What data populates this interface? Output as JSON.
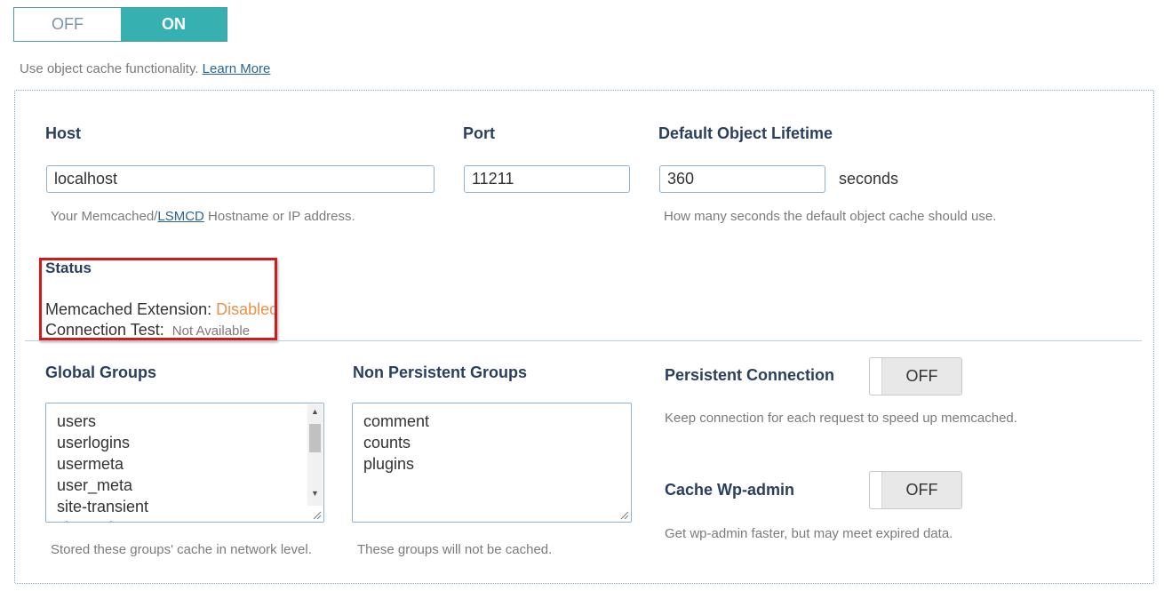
{
  "object_cache_toggle": {
    "off_label": "OFF",
    "on_label": "ON",
    "selected": "ON"
  },
  "intro": {
    "text": "Use object cache functionality.",
    "link_label": "Learn More"
  },
  "host": {
    "label": "Host",
    "value": "localhost",
    "help_prefix": "Your Memcached/",
    "help_link": "LSMCD",
    "help_suffix": " Hostname or IP address."
  },
  "port": {
    "label": "Port",
    "value": "11211"
  },
  "lifetime": {
    "label": "Default Object Lifetime",
    "value": "360",
    "unit": "seconds",
    "help": "How many seconds the default object cache should use."
  },
  "status": {
    "title": "Status",
    "extension_label": "Memcached Extension:",
    "extension_value": "Disabled",
    "connection_label": "Connection Test:",
    "connection_value": "Not Available"
  },
  "global_groups": {
    "label": "Global Groups",
    "items": [
      "users",
      "userlogins",
      "usermeta",
      "user_meta",
      "site-transient",
      "site-options"
    ],
    "help": "Stored these groups' cache in network level."
  },
  "non_persistent_groups": {
    "label": "Non Persistent Groups",
    "items": [
      "comment",
      "counts",
      "plugins"
    ],
    "help": "These groups will not be cached."
  },
  "persistent_connection": {
    "label": "Persistent Connection",
    "state": "OFF",
    "help": "Keep connection for each request to speed up memcached."
  },
  "cache_wp_admin": {
    "label": "Cache Wp-admin",
    "state": "OFF",
    "help": "Get wp-admin faster, but may meet expired data."
  },
  "colors": {
    "accent": "#36b0b0",
    "warning": "#e8924a",
    "highlight_box": "#d21a1a",
    "heading": "#2a3f5f"
  }
}
